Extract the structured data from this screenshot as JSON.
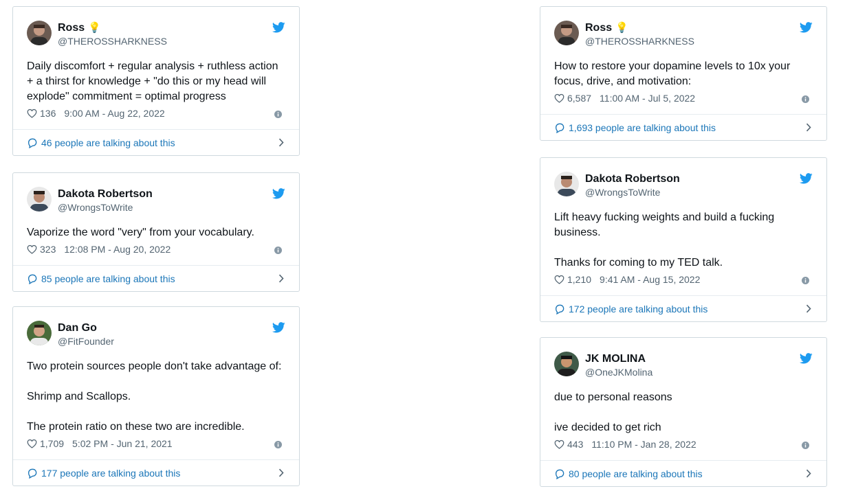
{
  "tweets": [
    {
      "name": "Ross",
      "badge": "💡",
      "handle": "@THEROSSHARKNESS",
      "text": "Daily discomfort + regular analysis + ruthless action + a thirst for knowledge + \"do this or my head will explode\" commitment = optimal progress",
      "likes": "136",
      "time": "9:00 AM - Aug 22, 2022",
      "talking": "46 people are talking about this"
    },
    {
      "name": "Dakota Robertson",
      "handle": "@WrongsToWrite",
      "text": "Vaporize the word \"very\" from your vocabulary.",
      "likes": "323",
      "time": "12:08 PM - Aug 20, 2022",
      "talking": "85 people are talking about this"
    },
    {
      "name": "Dan Go",
      "handle": "@FitFounder",
      "text": "Two protein sources people don't take advantage of:\n\nShrimp and Scallops.\n\nThe protein ratio on these two are incredible.",
      "likes": "1,709",
      "time": "5:02 PM - Jun 21, 2021",
      "talking": "177 people are talking about this"
    },
    {
      "name": "Ross",
      "badge": "💡",
      "handle": "@THEROSSHARKNESS",
      "text": "How to restore your dopamine levels to 10x your focus, drive, and motivation:",
      "likes": "6,587",
      "time": "11:00 AM - Jul 5, 2022",
      "talking": "1,693 people are talking about this"
    },
    {
      "name": "Dakota Robertson",
      "handle": "@WrongsToWrite",
      "text": "Lift heavy fucking weights and build a fucking business.\n\nThanks for coming to my TED talk.",
      "likes": "1,210",
      "time": "9:41 AM - Aug 15, 2022",
      "talking": "172 people are talking about this"
    },
    {
      "name": "JK MOLINA",
      "handle": "@OneJKMolina",
      "text": "due to personal reasons\n\nive decided to get rich",
      "likes": "443",
      "time": "11:10 PM - Jan 28, 2022",
      "talking": "80 people are talking about this"
    }
  ],
  "icons": {
    "brand": "twitter-bird-icon",
    "like": "heart-icon",
    "info": "info-icon",
    "reply": "speech-bubble-icon",
    "more": "chevron-right-icon"
  },
  "colors": {
    "twitter_blue": "#1d9bf0",
    "link_blue": "#1b76b8",
    "border": "#cfd9de",
    "muted": "#536471"
  }
}
